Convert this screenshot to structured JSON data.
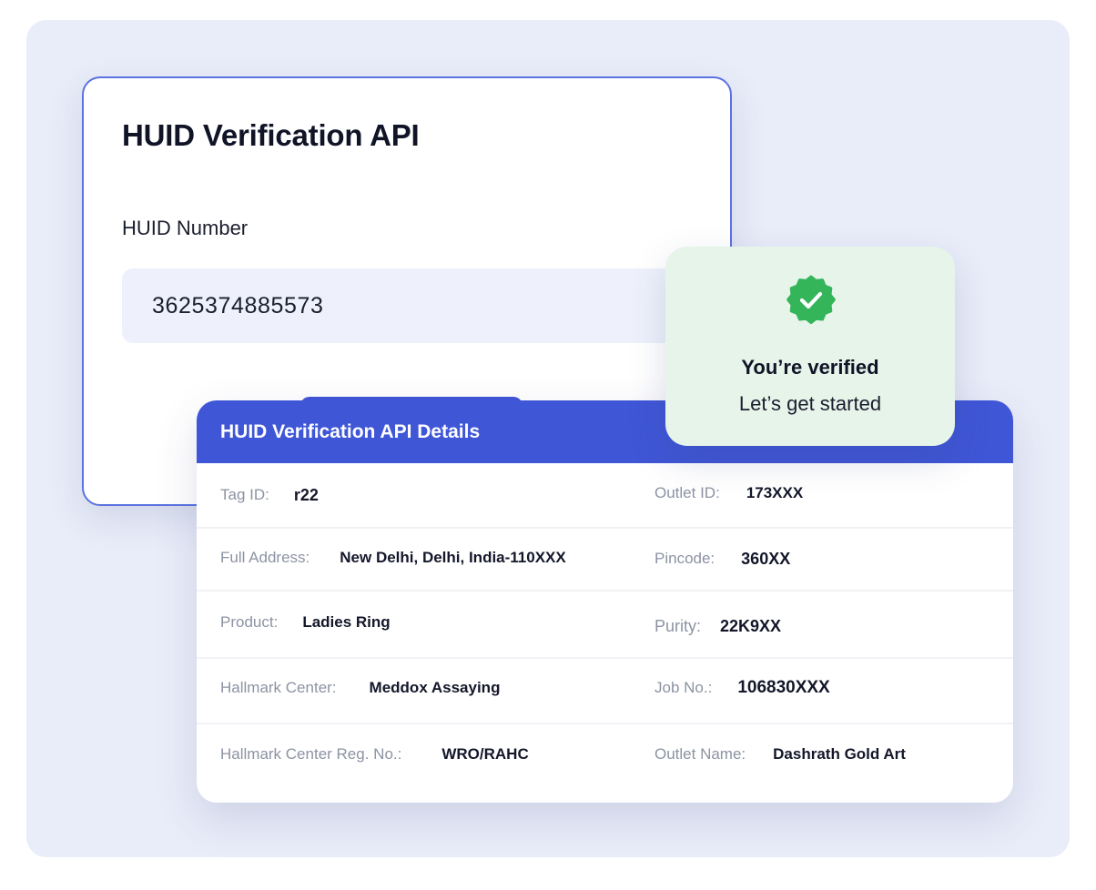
{
  "verification_form": {
    "title": "HUID Verification API",
    "field_label": "HUID Number",
    "field_value": "3625374885573"
  },
  "details": {
    "header": "HUID Verification API Details",
    "rows": [
      [
        {
          "label": "Tag ID:",
          "value": "r22"
        },
        {
          "label": "Outlet ID:",
          "value": "173XXX"
        }
      ],
      [
        {
          "label": "Full Address:",
          "value": "New Delhi, Delhi, India-110XXX"
        },
        {
          "label": "Pincode:",
          "value": "360XX"
        }
      ],
      [
        {
          "label": "Product:",
          "value": "Ladies Ring"
        },
        {
          "label": "Purity:",
          "value": "22K9XX"
        }
      ],
      [
        {
          "label": "Hallmark Center:",
          "value": "Meddox Assaying"
        },
        {
          "label": "Job No.:",
          "value": "106830XXX"
        }
      ],
      [
        {
          "label": "Hallmark Center Reg. No.:",
          "value": "WRO/RAHC"
        },
        {
          "label": "Outlet Name:",
          "value": "Dashrath Gold Art"
        }
      ]
    ]
  },
  "verified_popup": {
    "icon": "verified-badge-icon",
    "title": "You’re verified",
    "subtitle": "Let’s get started"
  },
  "colors": {
    "accent": "#3f56d6",
    "success": "#34b55a",
    "success_bg": "#e6f4ea",
    "canvas_bg": "#e9edf9"
  }
}
